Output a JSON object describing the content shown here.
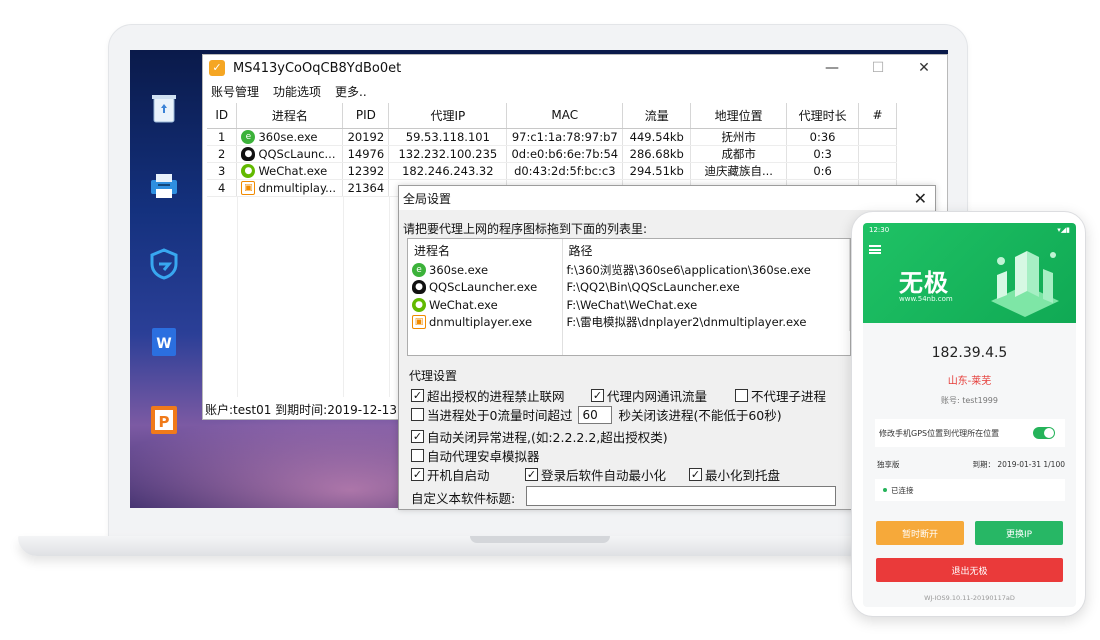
{
  "main_window": {
    "title": "MS413yCoOqCB8YdBo0et",
    "app_icon_glyph": "✓",
    "controls": {
      "minimize": "—",
      "maximize": "☐",
      "close": "✕"
    },
    "menu": [
      "账号管理",
      "功能选项",
      "更多.."
    ],
    "columns": [
      "ID",
      "进程名",
      "PID",
      "代理IP",
      "MAC",
      "流量",
      "地理位置",
      "代理时长",
      "#"
    ],
    "rows": [
      {
        "id": "1",
        "process": "360se.exe",
        "icon": "360-browser-icon",
        "pid": "20192",
        "ip": "59.53.118.101",
        "mac": "97:c1:1a:78:97:b7",
        "traffic": "449.54kb",
        "location": "抚州市",
        "duration": "0:36"
      },
      {
        "id": "2",
        "process": "QQScLaunc...",
        "icon": "qq-icon",
        "pid": "14976",
        "ip": "132.232.100.235",
        "mac": "0d:e0:b6:6e:7b:54",
        "traffic": "286.68kb",
        "location": "成都市",
        "duration": "0:3"
      },
      {
        "id": "3",
        "process": "WeChat.exe",
        "icon": "wechat-icon",
        "pid": "12392",
        "ip": "182.246.243.32",
        "mac": "d0:43:2d:5f:bc:c3",
        "traffic": "294.51kb",
        "location": "迪庆藏族自...",
        "duration": "0:6"
      },
      {
        "id": "4",
        "process": "dnmultiplay...",
        "icon": "dnplayer-icon",
        "pid": "21364",
        "ip": "",
        "mac": "",
        "traffic": "",
        "location": "",
        "duration": ""
      }
    ],
    "status": "账户:test01  到期时间:2019-12-13"
  },
  "dialog": {
    "title": "全局设置",
    "close": "✕",
    "hint": "请把要代理上网的程序图标拖到下面的列表里:",
    "list_headers": [
      "进程名",
      "路径"
    ],
    "list_rows": [
      {
        "name": "360se.exe",
        "icon": "360-browser-icon",
        "path": "f:\\360浏览器\\360se6\\application\\360se.exe"
      },
      {
        "name": "QQScLauncher.exe",
        "icon": "qq-icon",
        "path": "F:\\QQ2\\Bin\\QQScLauncher.exe"
      },
      {
        "name": "WeChat.exe",
        "icon": "wechat-icon",
        "path": "F:\\WeChat\\WeChat.exe"
      },
      {
        "name": "dnmultiplayer.exe",
        "icon": "dnplayer-icon",
        "path": "F:\\雷电模拟器\\dnplayer2\\dnmultiplayer.exe"
      }
    ],
    "group_label": "代理设置",
    "options": {
      "block_unauth": {
        "label": "超出授权的进程禁止联网",
        "checked": true
      },
      "proxy_lan": {
        "label": "代理内网通讯流量",
        "checked": true
      },
      "no_child": {
        "label": "不代理子进程",
        "checked": false
      },
      "zero_traffic_prefix": {
        "label": "当进程处于0流量时间超过",
        "checked": false
      },
      "zero_traffic_seconds": "60",
      "zero_traffic_suffix": "秒关闭该进程(不能低于60秒)",
      "auto_close": {
        "label": "自动关闭异常进程,(如:2.2.2.2,超出授权类)",
        "checked": true
      },
      "auto_android": {
        "label": "自动代理安卓模拟器",
        "checked": false
      },
      "startup": {
        "label": "开机自启动",
        "checked": true
      },
      "minimize_login": {
        "label": "登录后软件自动最小化",
        "checked": true
      },
      "tray": {
        "label": "最小化到托盘",
        "checked": true
      }
    },
    "custom_title_label": "自定义本软件标题:",
    "custom_title_value": ""
  },
  "phone": {
    "time": "12:30",
    "logo": "无极",
    "url": "www.54nb.com",
    "ip": "182.39.4.5",
    "region": "山东-莱芜",
    "account": "账号: test1999",
    "gps_label": "修改手机GPS位置到代理所在位置",
    "edition": "独享版",
    "expiry": "到期： 2019-01-31 1/100",
    "connected": "已连接",
    "pause_button": "暂时断开",
    "change_ip_button": "更换IP",
    "exit_button": "退出无极",
    "footer": "WJ-IOS9.10.11-20190117aD"
  },
  "colors": {
    "accent_green": "#1fc265",
    "danger_red": "#ea3a3a",
    "warning_orange": "#f6a93a"
  }
}
